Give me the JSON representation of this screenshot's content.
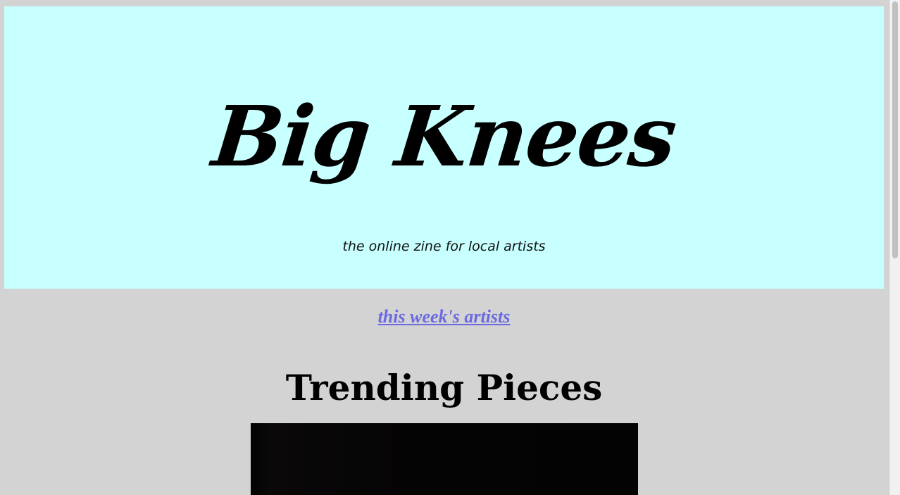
{
  "header": {
    "title": "Big Knees",
    "tagline": "the online zine for local artists"
  },
  "nav": {
    "artists_link": "this week's artists"
  },
  "trending": {
    "heading": "Trending Pieces",
    "image_icon": "artwork-image"
  },
  "colors": {
    "page_background": "#d3d3d3",
    "hero_background": "#c8ffff",
    "link": "#6b6be0",
    "text": "#000000"
  }
}
